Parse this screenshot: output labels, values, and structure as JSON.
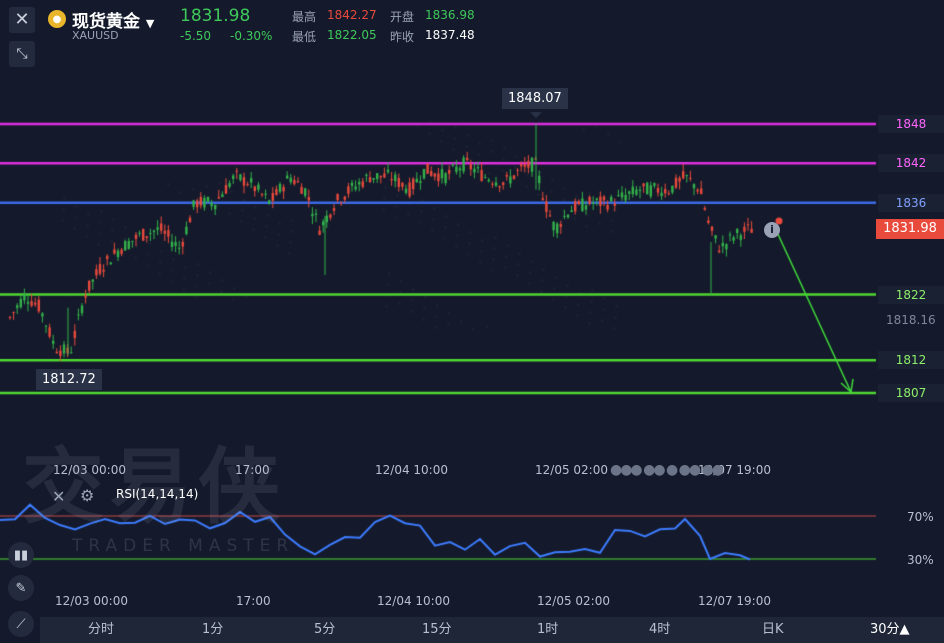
{
  "header": {
    "name": "现货黄金",
    "code": "XAUUSD",
    "price": "1831.98",
    "change": "-5.50",
    "change_pct": "-0.30%",
    "high_label": "最高",
    "high_value": "1842.27",
    "open_label": "开盘",
    "open_value": "1836.98",
    "low_label": "最低",
    "low_value": "1822.05",
    "prev_label": "昨收",
    "prev_value": "1837.48"
  },
  "annotations": {
    "max_label": "1848.07",
    "min_label": "1812.72",
    "current_price_tag": "1831.98",
    "mid_axis_value": "1818.16"
  },
  "levels": [
    {
      "label": "1848",
      "value": 1848,
      "color": "#e02fe0"
    },
    {
      "label": "1842",
      "value": 1842,
      "color": "#e02fe0"
    },
    {
      "label": "1836",
      "value": 1836,
      "color": "#3b6be8"
    },
    {
      "label": "1822",
      "value": 1822,
      "color": "#4fd832"
    },
    {
      "label": "1812",
      "value": 1812,
      "color": "#4fd832"
    },
    {
      "label": "1807",
      "value": 1807,
      "color": "#4fd832"
    }
  ],
  "time_axis_main": [
    "12/03 00:00",
    "17:00",
    "12/04 10:00",
    "12/05 02:00",
    "12/07 19:00"
  ],
  "time_axis_rsi": [
    "12/03 00:00",
    "17:00",
    "12/04 10:00",
    "12/05 02:00",
    "12/07 19:00"
  ],
  "rsi": {
    "title": "RSI(14,14,14)",
    "upper_label": "70%",
    "lower_label": "30%"
  },
  "watermark": {
    "cn": "交易侠",
    "en": "TRADER MASTER"
  },
  "bottom_tabs": [
    "分时",
    "1分",
    "5分",
    "15分",
    "1时",
    "4时",
    "日K",
    "30分▲"
  ],
  "colors": {
    "up": "#e84a3c",
    "down": "#33b24a",
    "bg": "#141a2b"
  },
  "chart_data": {
    "type": "candlestick",
    "price_range": [
      1804,
      1852
    ],
    "current": 1831.98,
    "high_marker": 1848.07,
    "low_marker": 1812.72
  }
}
